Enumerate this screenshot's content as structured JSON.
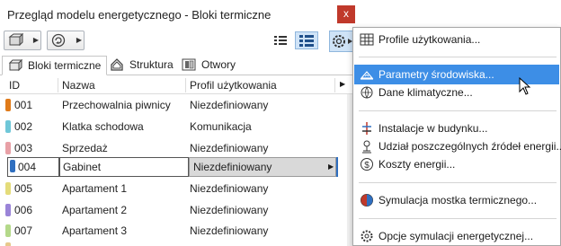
{
  "window": {
    "title": "Przegląd modelu energetycznego - Bloki termiczne",
    "close_glyph": "x"
  },
  "tabs": [
    {
      "label": "Bloki termiczne",
      "icon": "thermal-block-icon",
      "active": true
    },
    {
      "label": "Struktura",
      "icon": "house-outline-icon",
      "active": false
    },
    {
      "label": "Otwory",
      "icon": "window-opening-icon",
      "active": false
    }
  ],
  "table": {
    "columns": [
      "ID",
      "Nazwa",
      "Profil użytkowania"
    ],
    "rows": [
      {
        "id": "001",
        "name": "Przechowalnia piwnicy",
        "profile": "Niezdefiniowany",
        "color": "#e07b1a"
      },
      {
        "id": "002",
        "name": "Klatka schodowa",
        "profile": "Komunikacja",
        "color": "#6fc7d8"
      },
      {
        "id": "003",
        "name": "Sprzedaż",
        "profile": "Niezdefiniowany",
        "color": "#e8a0a6"
      },
      {
        "id": "004",
        "name": "Gabinet",
        "profile": "Niezdefiniowany",
        "color": "#2f6fc0",
        "selected": true
      },
      {
        "id": "005",
        "name": "Apartament 1",
        "profile": "Niezdefiniowany",
        "color": "#e4dc7a"
      },
      {
        "id": "006",
        "name": "Apartament 2",
        "profile": "Niezdefiniowany",
        "color": "#9a84d8"
      },
      {
        "id": "007",
        "name": "Apartament 3",
        "profile": "Niezdefiniowany",
        "color": "#b4d98a"
      },
      {
        "id": "008",
        "name": "",
        "profile": "",
        "color": "#e7c98c"
      }
    ]
  },
  "menu": {
    "items": [
      {
        "label": "Profile użytkowania...",
        "icon": "table-grid-icon"
      },
      {
        "label": "Parametry środowiska...",
        "icon": "environment-icon",
        "highlighted": true
      },
      {
        "label": "Dane klimatyczne...",
        "icon": "climate-data-icon"
      },
      {
        "label": "Instalacje w budynku...",
        "icon": "building-systems-icon"
      },
      {
        "label": "Udział poszczególnych źródeł energii...",
        "icon": "energy-sources-icon"
      },
      {
        "label": "Koszty energii...",
        "icon": "energy-cost-icon"
      },
      {
        "label": "Symulacja mostka termicznego...",
        "icon": "thermal-bridge-icon"
      },
      {
        "label": "Opcje symulacji energetycznej...",
        "icon": "simulation-options-icon"
      }
    ]
  },
  "colors": {
    "accent": "#3d8ee6",
    "close": "#c0392b",
    "selection": "#cfe3f7"
  }
}
